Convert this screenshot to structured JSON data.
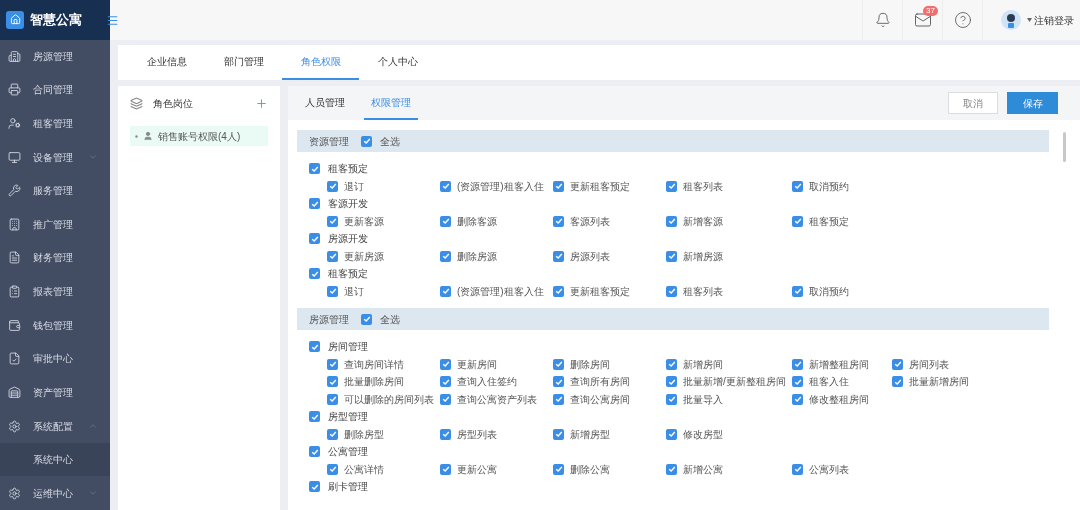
{
  "brand": {
    "title": "智慧公寓"
  },
  "header": {
    "mail_badge": "37",
    "logout": "注销登录"
  },
  "sidebar": {
    "items": [
      {
        "label": "房源管理",
        "kind": "link"
      },
      {
        "label": "合同管理",
        "kind": "link"
      },
      {
        "label": "租客管理",
        "kind": "link"
      },
      {
        "label": "设备管理",
        "kind": "group",
        "expanded": false
      },
      {
        "label": "服务管理",
        "kind": "link"
      },
      {
        "label": "推广管理",
        "kind": "link"
      },
      {
        "label": "财务管理",
        "kind": "link"
      },
      {
        "label": "报表管理",
        "kind": "link"
      },
      {
        "label": "钱包管理",
        "kind": "link"
      },
      {
        "label": "审批中心",
        "kind": "link"
      },
      {
        "label": "资产管理",
        "kind": "link"
      },
      {
        "label": "系统配置",
        "kind": "group",
        "expanded": true,
        "children": [
          {
            "label": "系统中心"
          }
        ]
      },
      {
        "label": "运维中心",
        "kind": "group",
        "expanded": false
      }
    ]
  },
  "tabs": [
    {
      "label": "企业信息",
      "selected": false
    },
    {
      "label": "部门管理",
      "selected": false
    },
    {
      "label": "角色权限",
      "selected": true
    },
    {
      "label": "个人中心",
      "selected": false
    }
  ],
  "roles": {
    "title": "角色岗位",
    "items": [
      {
        "label": "销售账号权限(4人)",
        "selected": true
      }
    ]
  },
  "subtabs": [
    {
      "label": "人员管理",
      "selected": false
    },
    {
      "label": "权限管理",
      "selected": true
    }
  ],
  "buttons": {
    "cancel": "取消",
    "save": "保存"
  },
  "sections": [
    {
      "title": "资源管理",
      "all_label": "全选",
      "all_checked": true,
      "groups": [
        {
          "label": "租客预定",
          "checked": true,
          "items": [
            {
              "label": "退订",
              "checked": true
            },
            {
              "label": "(资源管理)租客入住",
              "checked": true
            },
            {
              "label": "更新租客预定",
              "checked": true
            },
            {
              "label": "租客列表",
              "checked": true
            },
            {
              "label": "取消预约",
              "checked": true
            }
          ]
        },
        {
          "label": "客源开发",
          "checked": true,
          "items": [
            {
              "label": "更新客源",
              "checked": true
            },
            {
              "label": "删除客源",
              "checked": true
            },
            {
              "label": "客源列表",
              "checked": true
            },
            {
              "label": "新增客源",
              "checked": true
            },
            {
              "label": "租客预定",
              "checked": true
            }
          ]
        },
        {
          "label": "房源开发",
          "checked": true,
          "items": [
            {
              "label": "更新房源",
              "checked": true
            },
            {
              "label": "删除房源",
              "checked": true
            },
            {
              "label": "房源列表",
              "checked": true
            },
            {
              "label": "新增房源",
              "checked": true
            }
          ]
        },
        {
          "label": "租客预定",
          "checked": true,
          "items": [
            {
              "label": "退订",
              "checked": true
            },
            {
              "label": "(资源管理)租客入住",
              "checked": true
            },
            {
              "label": "更新租客预定",
              "checked": true
            },
            {
              "label": "租客列表",
              "checked": true
            },
            {
              "label": "取消预约",
              "checked": true
            }
          ]
        }
      ]
    },
    {
      "title": "房源管理",
      "all_label": "全选",
      "all_checked": true,
      "groups": [
        {
          "label": "房间管理",
          "checked": true,
          "items": [
            {
              "label": "查询房间详情",
              "checked": true
            },
            {
              "label": "更新房间",
              "checked": true
            },
            {
              "label": "删除房间",
              "checked": true
            },
            {
              "label": "新增房间",
              "checked": true
            },
            {
              "label": "新增整租房间",
              "checked": true
            },
            {
              "label": "房间列表",
              "checked": true
            },
            {
              "label": "批量删除房间",
              "checked": true
            },
            {
              "label": "查询入住签约",
              "checked": true
            },
            {
              "label": "查询所有房间",
              "checked": true
            },
            {
              "label": "批量新增/更新整租房间",
              "checked": true
            },
            {
              "label": "租客入住",
              "checked": true
            },
            {
              "label": "批量新增房间",
              "checked": true
            },
            {
              "label": "可以删除的房间列表",
              "checked": true
            },
            {
              "label": "查询公寓资产列表",
              "checked": true
            },
            {
              "label": "查询公寓房间",
              "checked": true
            },
            {
              "label": "批量导入",
              "checked": true
            },
            {
              "label": "修改整租房间",
              "checked": true
            }
          ]
        },
        {
          "label": "房型管理",
          "checked": true,
          "items": [
            {
              "label": "删除房型",
              "checked": true
            },
            {
              "label": "房型列表",
              "checked": true
            },
            {
              "label": "新增房型",
              "checked": true
            },
            {
              "label": "修改房型",
              "checked": true
            }
          ]
        },
        {
          "label": "公寓管理",
          "checked": true,
          "items": [
            {
              "label": "公寓详情",
              "checked": true
            },
            {
              "label": "更新公寓",
              "checked": true
            },
            {
              "label": "删除公寓",
              "checked": true
            },
            {
              "label": "新增公寓",
              "checked": true
            },
            {
              "label": "公寓列表",
              "checked": true
            }
          ]
        },
        {
          "label": "刷卡管理",
          "checked": true
        }
      ]
    }
  ]
}
